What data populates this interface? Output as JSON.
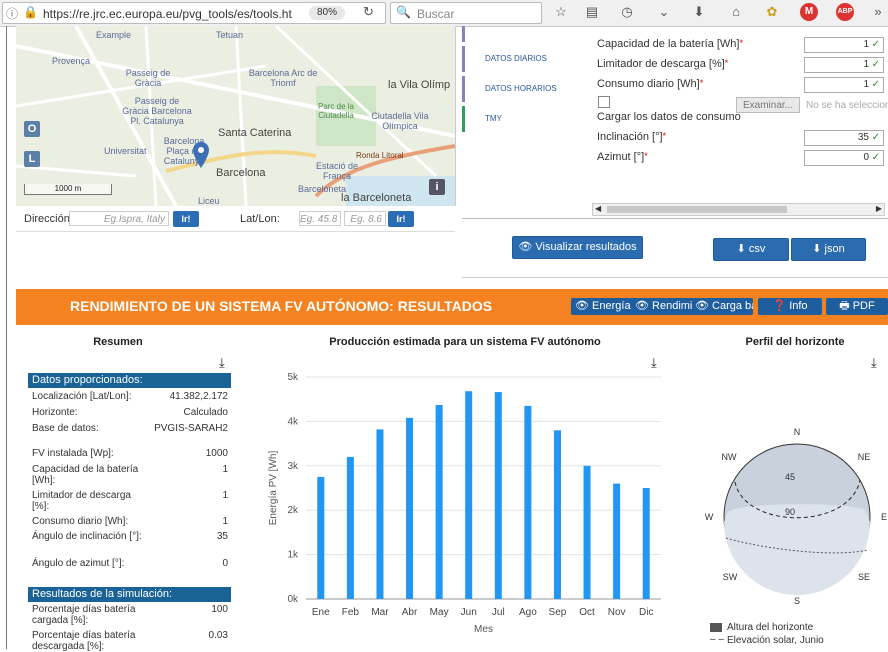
{
  "browser": {
    "url": "https://re.jrc.ec.europa.eu/pvg_tools/es/tools.ht",
    "zoom": "80%",
    "search_placeholder": "Buscar",
    "icons": [
      "info-icon",
      "lock-icon",
      "reload-icon",
      "search-icon",
      "star-icon",
      "reader-icon",
      "history-icon",
      "pocket-icon",
      "download-icon",
      "home-icon",
      "extension-icon",
      "gmail-icon",
      "adblock-icon",
      "overflow-icon"
    ]
  },
  "map": {
    "labels": [
      "Example",
      "Tetuan",
      "Provença",
      "Passeig de Gràcia",
      "Barcelona Arc de Triomf",
      "la Vila Olímp",
      "Passeig de Gràcia Barcelona Pl. Catalunya",
      "Parc de la Ciutadella",
      "Ciutadella Vila Olímpica",
      "Santa Caterina",
      "Universitat",
      "Barcelona Plaça de Catalunya",
      "Ronda Litoral",
      "Estació de França",
      "Barcelona",
      "Barceloneta",
      "la Barceloneta",
      "Liceu"
    ],
    "scale": "1000 m",
    "btn_o": "O",
    "btn_l": "L",
    "btn_info": "i"
  },
  "location_form": {
    "address_label": "Dirección",
    "address_placeholder": "Eg.Ispra, Italy",
    "go_label": "Ir!",
    "latlon_label": "Lat/Lon:",
    "lat_placeholder": "Eg. 45.8",
    "lon_placeholder": "Eg. 8.6",
    "go2_label": "Ir!"
  },
  "tabs": [
    "DATOS DIARIOS",
    "DATOS HORARIOS",
    "TMY"
  ],
  "params": {
    "battery": {
      "label": "Capacidad de la batería [Wh]",
      "value": "1"
    },
    "discharge": {
      "label": "Limitador de descarga [%]",
      "value": "1"
    },
    "consumption": {
      "label": "Consumo diario [Wh]",
      "value": "1"
    },
    "load_label": "Cargar los datos de consumo",
    "browse_label": "Examinar...",
    "no_file": "No se ha selecciona",
    "tilt": {
      "label": "Inclinación [°]",
      "value": "35"
    },
    "azimuth": {
      "label": "Azimut [°]",
      "value": "0"
    }
  },
  "actions": {
    "visualize": "Visualizar resultados",
    "csv": "csv",
    "json": "json"
  },
  "results": {
    "title": "RENDIMIENTO DE UN SISTEMA FV AUTÓNOMO: RESULTADOS",
    "tabs": [
      "Energía",
      "Rendimi",
      "Carga ba"
    ],
    "info": "Info",
    "pdf": "PDF"
  },
  "summary": {
    "title": "Resumen",
    "provided_title": "Datos proporcionados:",
    "provided": [
      {
        "k": "Localización [Lat/Lon]:",
        "v": "41.382,2.172"
      },
      {
        "k": "Horizonte:",
        "v": "Calculado"
      },
      {
        "k": "Base de datos:",
        "v": "PVGIS-SARAH2"
      },
      {
        "k": "FV instalada [Wp]:",
        "v": "1000"
      },
      {
        "k": "Capacidad de la batería [Wh]:",
        "v": "1"
      },
      {
        "k": "Limitador de descarga [%]:",
        "v": "1"
      },
      {
        "k": "Consumo diario [Wh]:",
        "v": "1"
      },
      {
        "k": "Ángulo de inclinación [°]:",
        "v": "35"
      },
      {
        "k": "Ángulo de azimut [°]:",
        "v": "0"
      }
    ],
    "sim_title": "Resultados de la simulación:",
    "sim": [
      {
        "k": "Porcentaje días batería cargada [%]:",
        "v": "100"
      },
      {
        "k": "Porcentaje días batería descargada [%]:",
        "v": "0.03"
      }
    ]
  },
  "chart_data": {
    "type": "bar",
    "title": "Producción estimada para un sistema FV autónomo",
    "xlabel": "Mes",
    "ylabel": "Energía PV [Wh]",
    "categories": [
      "Ene",
      "Feb",
      "Mar",
      "Abr",
      "May",
      "Jun",
      "Jul",
      "Ago",
      "Sep",
      "Oct",
      "Nov",
      "Dic"
    ],
    "values": [
      2750,
      3200,
      3820,
      4080,
      4370,
      4680,
      4660,
      4350,
      3800,
      3000,
      2600,
      2500
    ],
    "ylim": [
      0,
      5000
    ],
    "yticks": [
      "0k",
      "1k",
      "2k",
      "3k",
      "4k",
      "5k"
    ],
    "grid": true,
    "color": "#2196f3"
  },
  "horizon": {
    "title": "Perfil del horizonte",
    "dirs": {
      "n": "N",
      "ne": "NE",
      "e": "E",
      "se": "SE",
      "s": "S",
      "sw": "SW",
      "w": "W",
      "nw": "NW"
    },
    "ring45": "45",
    "ring90": "90",
    "legend_horizon": "Altura del horizonte",
    "legend_solar": "Elevación solar, Junio"
  }
}
